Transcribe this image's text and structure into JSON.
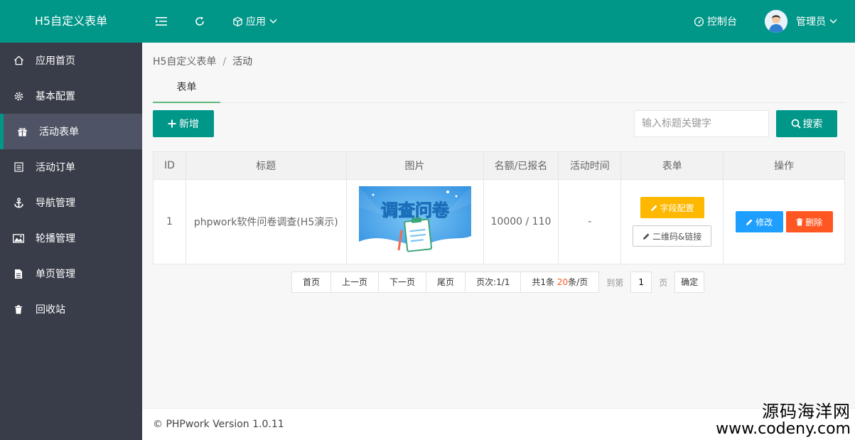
{
  "header": {
    "logo": "H5自定义表单",
    "app_menu": "应用",
    "console": "控制台",
    "user": "管理员"
  },
  "sidebar": {
    "items": [
      {
        "label": "应用首页",
        "icon": "home-icon"
      },
      {
        "label": "基本配置",
        "icon": "gear-icon"
      },
      {
        "label": "活动表单",
        "icon": "gift-icon",
        "active": true
      },
      {
        "label": "活动订单",
        "icon": "list-icon"
      },
      {
        "label": "导航管理",
        "icon": "anchor-icon"
      },
      {
        "label": "轮播管理",
        "icon": "image-icon"
      },
      {
        "label": "单页管理",
        "icon": "file-icon"
      },
      {
        "label": "回收站",
        "icon": "trash-icon"
      }
    ]
  },
  "breadcrumb": {
    "parent": "H5自定义表单",
    "sep": "/",
    "current": "活动"
  },
  "tabs": [
    {
      "label": "表单"
    }
  ],
  "toolbar": {
    "add_label": "新增",
    "search_placeholder": "输入标题关键字",
    "search_label": "搜索"
  },
  "table": {
    "headers": [
      "ID",
      "标题",
      "图片",
      "名额/已报名",
      "活动时间",
      "表单",
      "操作"
    ],
    "rows": [
      {
        "id": "1",
        "title": "phpwork软件问卷调查(H5演示)",
        "image_text": "调查问卷",
        "quota": "10000 / 110",
        "time": "-",
        "field_config": "字段配置",
        "qrcode": "二维码&链接",
        "edit": "修改",
        "delete": "删除"
      }
    ]
  },
  "pagination": {
    "first": "首页",
    "prev": "上一页",
    "next": "下一页",
    "last": "尾页",
    "page_prefix": "页次:",
    "page_value": "1/1",
    "total_prefix": "共1条 ",
    "per_page": "20",
    "per_page_suffix": "条/页",
    "goto": "到第",
    "page_input": "1",
    "page_unit": "页",
    "confirm": "确定"
  },
  "footer": {
    "text": "© PHPwork Version 1.0.11"
  },
  "watermark": {
    "line1": "源码海洋网",
    "line2": "www.codeny.com"
  },
  "colors": {
    "primary": "#009688",
    "sidebar": "#393d49",
    "warn": "#ffb800",
    "blue": "#1e9fff",
    "danger": "#ff5722"
  }
}
